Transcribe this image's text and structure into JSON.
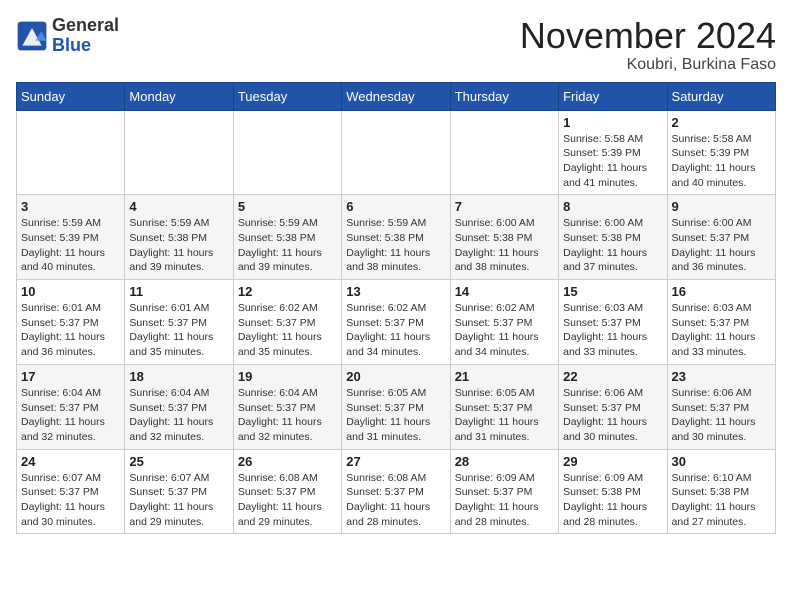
{
  "header": {
    "logo_general": "General",
    "logo_blue": "Blue",
    "title": "November 2024",
    "subtitle": "Koubri, Burkina Faso"
  },
  "weekdays": [
    "Sunday",
    "Monday",
    "Tuesday",
    "Wednesday",
    "Thursday",
    "Friday",
    "Saturday"
  ],
  "weeks": [
    [
      {
        "day": "",
        "info": ""
      },
      {
        "day": "",
        "info": ""
      },
      {
        "day": "",
        "info": ""
      },
      {
        "day": "",
        "info": ""
      },
      {
        "day": "",
        "info": ""
      },
      {
        "day": "1",
        "info": "Sunrise: 5:58 AM\nSunset: 5:39 PM\nDaylight: 11 hours\nand 41 minutes."
      },
      {
        "day": "2",
        "info": "Sunrise: 5:58 AM\nSunset: 5:39 PM\nDaylight: 11 hours\nand 40 minutes."
      }
    ],
    [
      {
        "day": "3",
        "info": "Sunrise: 5:59 AM\nSunset: 5:39 PM\nDaylight: 11 hours\nand 40 minutes."
      },
      {
        "day": "4",
        "info": "Sunrise: 5:59 AM\nSunset: 5:38 PM\nDaylight: 11 hours\nand 39 minutes."
      },
      {
        "day": "5",
        "info": "Sunrise: 5:59 AM\nSunset: 5:38 PM\nDaylight: 11 hours\nand 39 minutes."
      },
      {
        "day": "6",
        "info": "Sunrise: 5:59 AM\nSunset: 5:38 PM\nDaylight: 11 hours\nand 38 minutes."
      },
      {
        "day": "7",
        "info": "Sunrise: 6:00 AM\nSunset: 5:38 PM\nDaylight: 11 hours\nand 38 minutes."
      },
      {
        "day": "8",
        "info": "Sunrise: 6:00 AM\nSunset: 5:38 PM\nDaylight: 11 hours\nand 37 minutes."
      },
      {
        "day": "9",
        "info": "Sunrise: 6:00 AM\nSunset: 5:37 PM\nDaylight: 11 hours\nand 36 minutes."
      }
    ],
    [
      {
        "day": "10",
        "info": "Sunrise: 6:01 AM\nSunset: 5:37 PM\nDaylight: 11 hours\nand 36 minutes."
      },
      {
        "day": "11",
        "info": "Sunrise: 6:01 AM\nSunset: 5:37 PM\nDaylight: 11 hours\nand 35 minutes."
      },
      {
        "day": "12",
        "info": "Sunrise: 6:02 AM\nSunset: 5:37 PM\nDaylight: 11 hours\nand 35 minutes."
      },
      {
        "day": "13",
        "info": "Sunrise: 6:02 AM\nSunset: 5:37 PM\nDaylight: 11 hours\nand 34 minutes."
      },
      {
        "day": "14",
        "info": "Sunrise: 6:02 AM\nSunset: 5:37 PM\nDaylight: 11 hours\nand 34 minutes."
      },
      {
        "day": "15",
        "info": "Sunrise: 6:03 AM\nSunset: 5:37 PM\nDaylight: 11 hours\nand 33 minutes."
      },
      {
        "day": "16",
        "info": "Sunrise: 6:03 AM\nSunset: 5:37 PM\nDaylight: 11 hours\nand 33 minutes."
      }
    ],
    [
      {
        "day": "17",
        "info": "Sunrise: 6:04 AM\nSunset: 5:37 PM\nDaylight: 11 hours\nand 32 minutes."
      },
      {
        "day": "18",
        "info": "Sunrise: 6:04 AM\nSunset: 5:37 PM\nDaylight: 11 hours\nand 32 minutes."
      },
      {
        "day": "19",
        "info": "Sunrise: 6:04 AM\nSunset: 5:37 PM\nDaylight: 11 hours\nand 32 minutes."
      },
      {
        "day": "20",
        "info": "Sunrise: 6:05 AM\nSunset: 5:37 PM\nDaylight: 11 hours\nand 31 minutes."
      },
      {
        "day": "21",
        "info": "Sunrise: 6:05 AM\nSunset: 5:37 PM\nDaylight: 11 hours\nand 31 minutes."
      },
      {
        "day": "22",
        "info": "Sunrise: 6:06 AM\nSunset: 5:37 PM\nDaylight: 11 hours\nand 30 minutes."
      },
      {
        "day": "23",
        "info": "Sunrise: 6:06 AM\nSunset: 5:37 PM\nDaylight: 11 hours\nand 30 minutes."
      }
    ],
    [
      {
        "day": "24",
        "info": "Sunrise: 6:07 AM\nSunset: 5:37 PM\nDaylight: 11 hours\nand 30 minutes."
      },
      {
        "day": "25",
        "info": "Sunrise: 6:07 AM\nSunset: 5:37 PM\nDaylight: 11 hours\nand 29 minutes."
      },
      {
        "day": "26",
        "info": "Sunrise: 6:08 AM\nSunset: 5:37 PM\nDaylight: 11 hours\nand 29 minutes."
      },
      {
        "day": "27",
        "info": "Sunrise: 6:08 AM\nSunset: 5:37 PM\nDaylight: 11 hours\nand 28 minutes."
      },
      {
        "day": "28",
        "info": "Sunrise: 6:09 AM\nSunset: 5:37 PM\nDaylight: 11 hours\nand 28 minutes."
      },
      {
        "day": "29",
        "info": "Sunrise: 6:09 AM\nSunset: 5:38 PM\nDaylight: 11 hours\nand 28 minutes."
      },
      {
        "day": "30",
        "info": "Sunrise: 6:10 AM\nSunset: 5:38 PM\nDaylight: 11 hours\nand 27 minutes."
      }
    ]
  ]
}
